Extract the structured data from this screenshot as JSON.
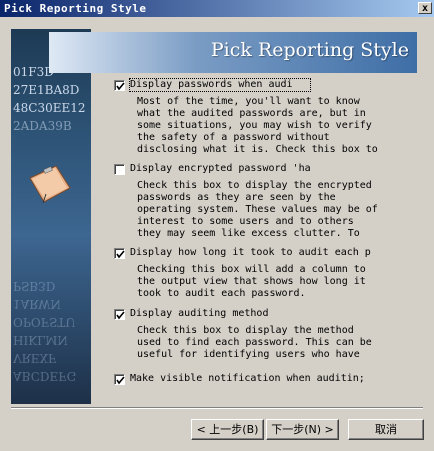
{
  "window": {
    "title": "Pick Reporting Style",
    "close_glyph": "x"
  },
  "side_panel": {
    "code_lines": [
      "01F3D",
      "27E1BA8D",
      "48C30EE12",
      "2ADA39B"
    ],
    "mirrored_lines": [
      "PSB3D",
      "1ARWN",
      "OPOFSTU",
      "HIKLMN",
      "VREXF",
      "ABCDEFG"
    ],
    "image_icon": "clipboard-image"
  },
  "header": {
    "title": "Pick Reporting Style"
  },
  "options": [
    {
      "label": "Display passwords when audi",
      "checked": true,
      "description": [
        "Most of the time, you'll want to know",
        "what the audited passwords are, but in",
        "some situations, you may wish to verify",
        "the safety of a password without",
        "disclosing what it is. Check this box to"
      ]
    },
    {
      "label": "Display encrypted password 'ha",
      "checked": false,
      "description": [
        "Check this box to display the encrypted",
        "passwords as they are seen by the",
        "operating system. These values may be of",
        "interest to some users and to others",
        "they may seem like excess clutter. To"
      ]
    },
    {
      "label": "Display how long it took to audit each p",
      "checked": true,
      "description": [
        "Checking this box will add a column to",
        "the output view that shows how long it",
        "took to audit each password."
      ]
    },
    {
      "label": "Display auditing method",
      "checked": true,
      "description": [
        "Check this box to display the method",
        "used to find each password.  This can be",
        "useful for identifying users who have"
      ]
    },
    {
      "label": "Make visible notification when auditin;",
      "checked": true,
      "description": []
    }
  ],
  "buttons": {
    "back": "< 上一步(B)",
    "next": "下一步(N) >",
    "cancel": "取消"
  }
}
